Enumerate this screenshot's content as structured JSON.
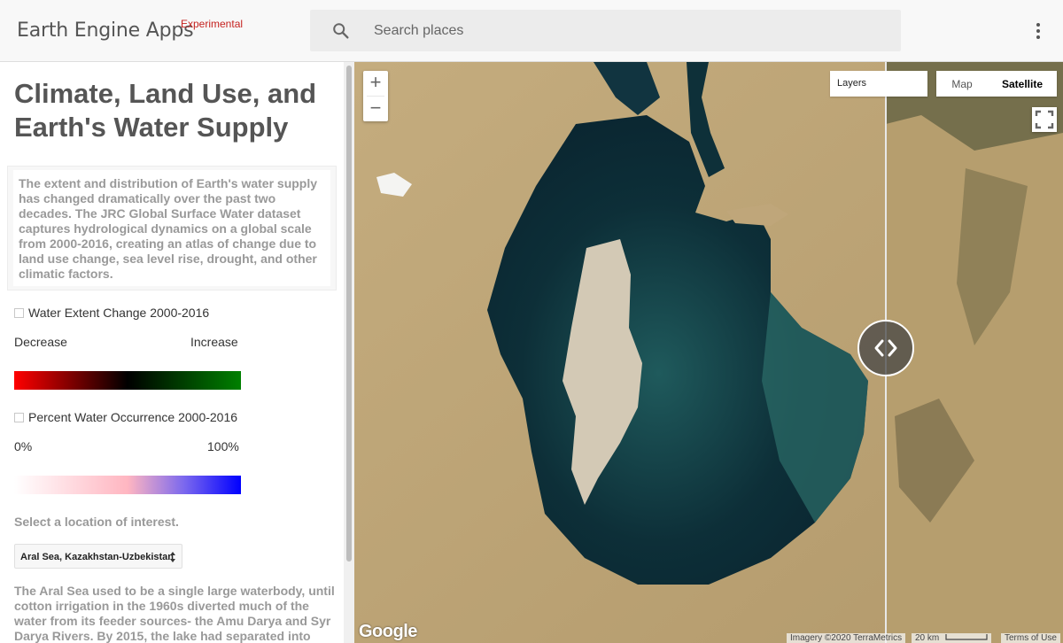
{
  "header": {
    "brand": "Earth Engine Apps",
    "brand_tag": "Experimental",
    "search_placeholder": "Search places"
  },
  "panel": {
    "title": "Climate, Land Use, and Earth's Water Supply",
    "description": "The extent and distribution of Earth's water supply has changed dramatically over the past two decades. The JRC Global Surface Water dataset captures hydrological dynamics on a global scale from 2000-2016, creating an atlas of change due to land use change, sea level rise, drought, and other climatic factors.",
    "layer1": {
      "label": "Water Extent Change 2000-2016",
      "checked": false,
      "min_label": "Decrease",
      "max_label": "Increase",
      "colors": [
        "#ff0000",
        "#000000",
        "#008000"
      ]
    },
    "layer2": {
      "label": "Percent Water Occurrence 2000-2016",
      "checked": false,
      "min_label": "0%",
      "max_label": "100%",
      "colors": [
        "#ffffff",
        "#ffb6c1",
        "#7b68ee",
        "#0000ff"
      ]
    },
    "select_label": "Select a location of interest.",
    "select_value": "Aral Sea, Kazakhstan-Uzbekistan",
    "story": "The Aral Sea used to be a single large waterbody, until cotton irrigation in the 1960s diverted much of the water from its feeder sources- the Amu Darya and Syr Darya Rivers. By 2015, the lake had separated into four"
  },
  "map": {
    "zoom_in": "+",
    "zoom_out": "−",
    "layers_label": "Layers",
    "map_type": {
      "map": "Map",
      "satellite": "Satellite",
      "selected": "Satellite"
    },
    "google_logo": "Google",
    "imagery": "Imagery ©2020 TerraMetrics",
    "scale": "20 km",
    "terms": "Terms of Use"
  },
  "icons": {
    "search": "search-icon",
    "menu": "more-vert-icon",
    "fullscreen": "fullscreen-icon",
    "swipe": "swipe-handle-icon"
  }
}
